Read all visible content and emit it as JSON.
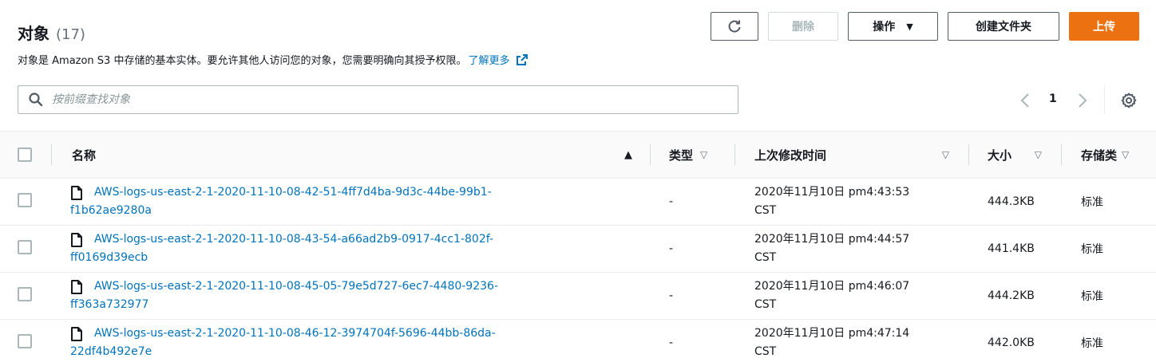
{
  "header": {
    "title": "对象",
    "count": "(17)",
    "description": "对象是 Amazon S3 中存储的基本实体。要允许其他人访问您的对象，您需要明确向其授予权限。",
    "learn_more": "了解更多"
  },
  "toolbar": {
    "delete_label": "删除",
    "actions_label": "操作",
    "actions_caret": "▼",
    "create_folder_label": "创建文件夹",
    "upload_label": "上传"
  },
  "search": {
    "placeholder": "按前缀查找对象"
  },
  "pagination": {
    "current_page": "1"
  },
  "table": {
    "columns": {
      "name": "名称",
      "type": "类型",
      "modified": "上次修改时间",
      "size": "大小",
      "storage_class": "存储类"
    },
    "sort_active": "▲",
    "sort_inactive": "▽",
    "rows": [
      {
        "name_line1": "AWS-logs-us-east-2-1-2020-11-10-08-42-51-4ff7d4ba-9d3c-44be-99b1-",
        "name_line2": "f1b62ae9280a",
        "type": "-",
        "modified_line1": "2020年11月10日 pm4:43:53",
        "modified_line2": "CST",
        "size": "444.3KB",
        "storage_class": "标准"
      },
      {
        "name_line1": "AWS-logs-us-east-2-1-2020-11-10-08-43-54-a66ad2b9-0917-4cc1-802f-",
        "name_line2": "ff0169d39ecb",
        "type": "-",
        "modified_line1": "2020年11月10日 pm4:44:57",
        "modified_line2": "CST",
        "size": "441.4KB",
        "storage_class": "标准"
      },
      {
        "name_line1": "AWS-logs-us-east-2-1-2020-11-10-08-45-05-79e5d727-6ec7-4480-9236-",
        "name_line2": "ff363a732977",
        "type": "-",
        "modified_line1": "2020年11月10日 pm4:46:07",
        "modified_line2": "CST",
        "size": "444.2KB",
        "storage_class": "标准"
      },
      {
        "name_line1": "AWS-logs-us-east-2-1-2020-11-10-08-46-12-3974704f-5696-44bb-86da-",
        "name_line2": "22df4b492e7e",
        "type": "-",
        "modified_line1": "2020年11月10日 pm4:47:14",
        "modified_line2": "CST",
        "size": "442.0KB",
        "storage_class": "标准"
      }
    ]
  },
  "colors": {
    "primary": "#ec7211",
    "link": "#0073bb",
    "text": "#16191f",
    "muted": "#687078"
  }
}
